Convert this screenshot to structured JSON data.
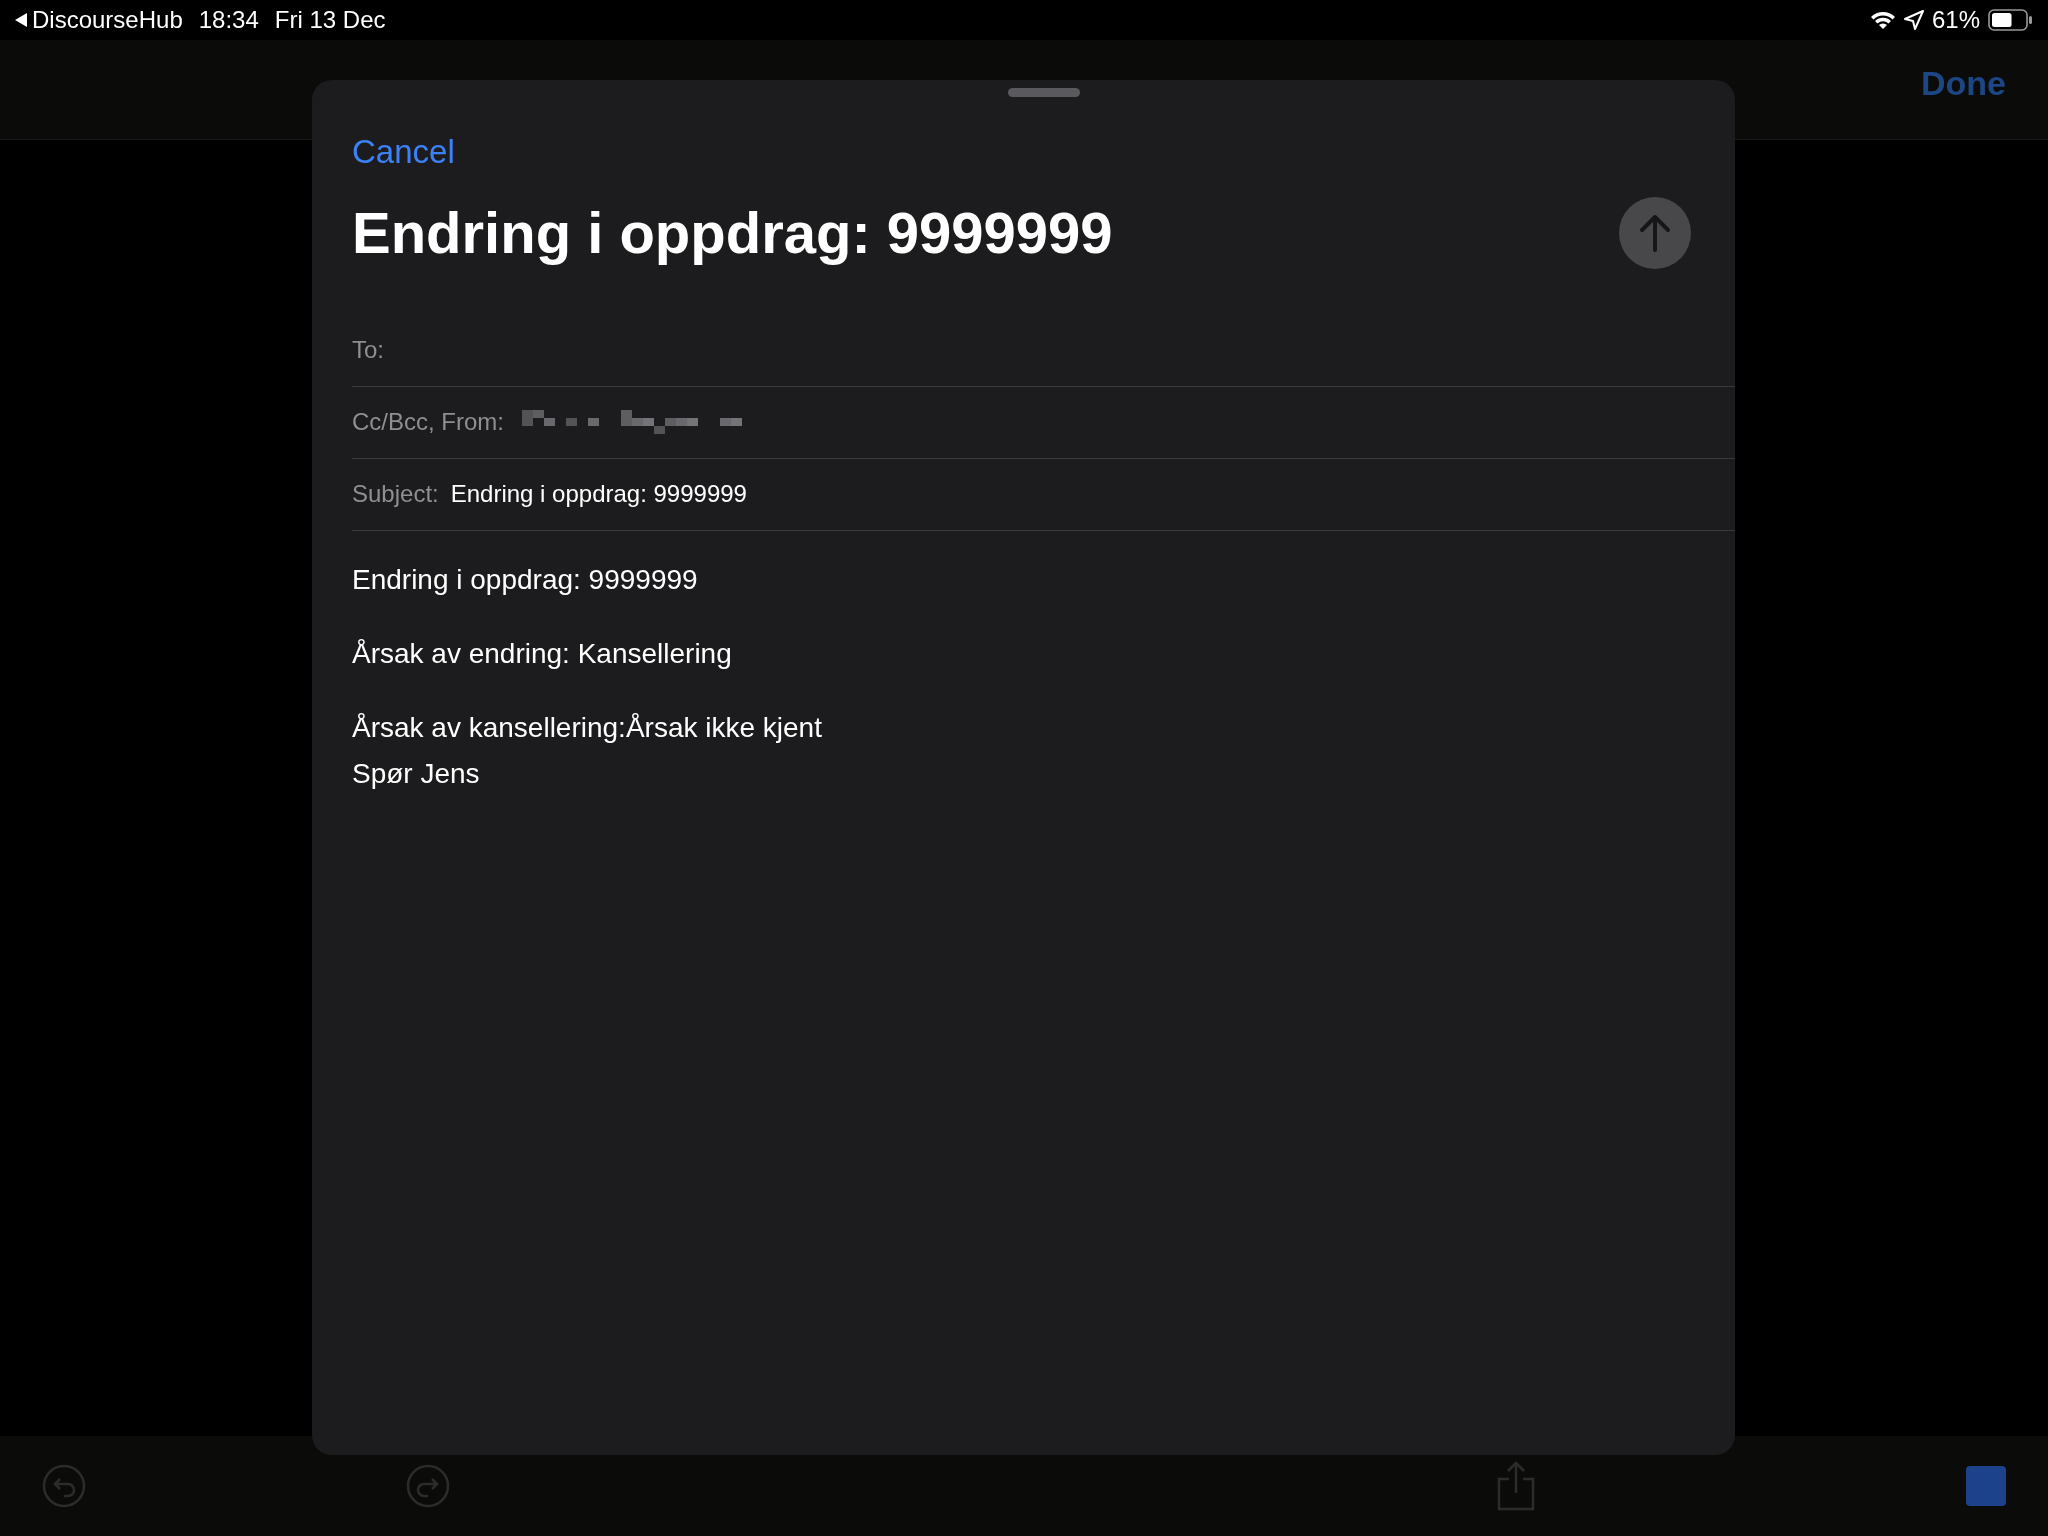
{
  "status_bar": {
    "back_app": "DiscourseHub",
    "time": "18:34",
    "date": "Fri 13 Dec",
    "battery": "61%"
  },
  "background_nav": {
    "done": "Done"
  },
  "compose": {
    "cancel": "Cancel",
    "title": "Endring i oppdrag: 9999999",
    "fields": [
      {
        "kind": "empty",
        "label": "To:"
      },
      {
        "kind": "redacted",
        "label": "Cc/Bcc, From:"
      },
      {
        "kind": "text",
        "label": "Subject:",
        "value": "Endring i oppdrag: 9999999"
      }
    ],
    "body": [
      {
        "lines": [
          "Endring i oppdrag: 9999999"
        ]
      },
      {
        "lines": [
          "Årsak av endring: Kansellering"
        ]
      },
      {
        "lines": [
          "Årsak av kansellering:Årsak ikke kjent",
          "Spør Jens"
        ]
      }
    ]
  }
}
